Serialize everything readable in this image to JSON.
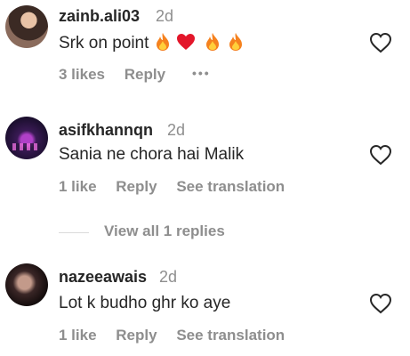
{
  "comments": [
    {
      "username": "zainb.ali03",
      "time": "2d",
      "text": "Srk on point",
      "emoji": [
        "fire-emoji",
        "red-heart-emoji",
        "fire-emoji",
        "fire-emoji"
      ],
      "likes": "3 likes",
      "reply": "Reply",
      "more": "•••"
    },
    {
      "username": "asifkhannqn",
      "time": "2d",
      "text": "Sania ne chora hai Malik",
      "likes": "1 like",
      "reply": "Reply",
      "translation": "See translation"
    },
    {
      "username": "nazeeawais",
      "time": "2d",
      "text": "Lot k budho ghr ko aye",
      "likes": "1 like",
      "reply": "Reply",
      "translation": "See translation"
    }
  ],
  "view_replies": "View all 1 replies",
  "icons": {
    "like": "heart-outline-icon",
    "more": "more-dots-icon"
  },
  "colors": {
    "text": "#262626",
    "secondary": "#8e8e8e",
    "heart_stroke": "#262626"
  }
}
